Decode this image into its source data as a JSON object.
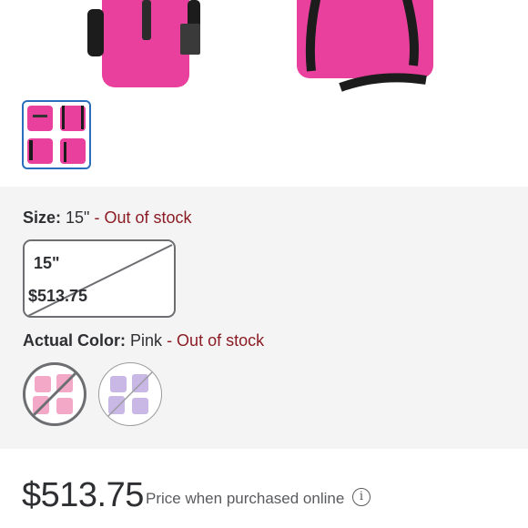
{
  "gallery": {
    "thumbnail_count": 1,
    "product_color": "#e83e9b"
  },
  "size": {
    "label": "Size:",
    "value": "15\"",
    "status": "- Out of stock",
    "options": [
      {
        "name": "15\"",
        "price": "$513.75",
        "available": false,
        "selected": true
      }
    ]
  },
  "color": {
    "label": "Actual Color:",
    "value": "Pink",
    "status": "- Out of stock",
    "swatches": [
      {
        "name": "Pink",
        "available": false,
        "selected": true,
        "hex": "#f3a8c8"
      },
      {
        "name": "Lavender",
        "available": false,
        "selected": false,
        "hex": "#c9b8e6"
      }
    ]
  },
  "price": {
    "amount": "$513.75",
    "note": "Price when purchased online",
    "info_icon_glyph": "i"
  },
  "colors": {
    "out_of_stock": "#8b1c24",
    "selection_border": "#2a6ebd"
  }
}
